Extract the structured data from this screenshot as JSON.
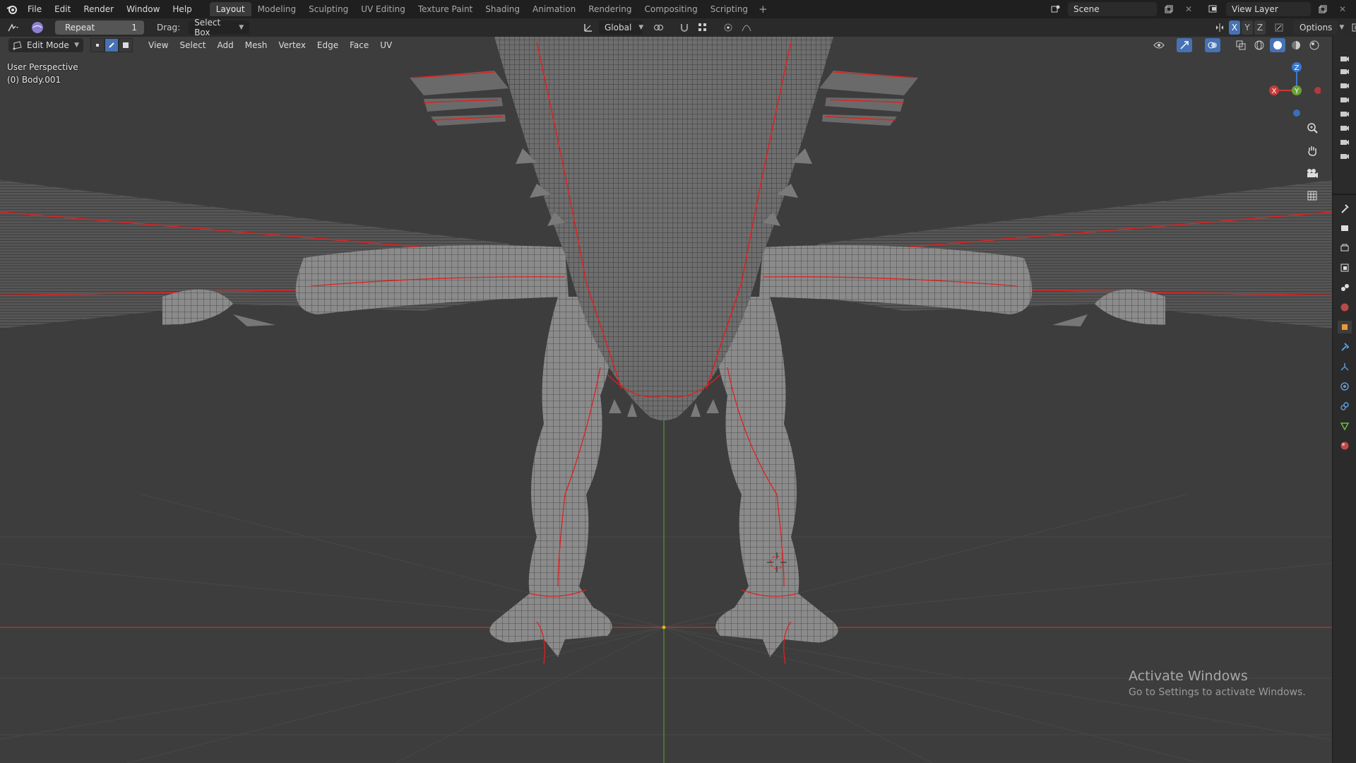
{
  "menus": [
    "File",
    "Edit",
    "Render",
    "Window",
    "Help"
  ],
  "workspaces": [
    "Layout",
    "Modeling",
    "Sculpting",
    "UV Editing",
    "Texture Paint",
    "Shading",
    "Animation",
    "Rendering",
    "Compositing",
    "Scripting"
  ],
  "active_workspace": "Layout",
  "scene": {
    "name": "Scene",
    "view_layer": "View Layer"
  },
  "tool_settings": {
    "repeat_label": "Repeat",
    "repeat_count": "1",
    "drag_label": "Drag:",
    "drag_value": "Select Box",
    "transform_orientation": "Global",
    "options_label": "Options",
    "axes": [
      "X",
      "Y",
      "Z"
    ]
  },
  "viewport_header": {
    "mode": "Edit Mode",
    "menus": [
      "View",
      "Select",
      "Add",
      "Mesh",
      "Vertex",
      "Edge",
      "Face",
      "UV"
    ]
  },
  "overlay": {
    "view_name": "User Perspective",
    "object_name": "(0) Body.001"
  },
  "gizmo_axes": {
    "z": "Z",
    "x": "X",
    "y": "Y"
  },
  "colors": {
    "accent": "#4772b3",
    "seam": "#e02020",
    "grid": "#4a4a4a",
    "x_axis": "#c83a3a",
    "y_axis": "#6aa236",
    "z_axis": "#3a78d0"
  },
  "watermark": {
    "title": "Activate Windows",
    "subtitle": "Go to Settings to activate Windows."
  },
  "icons": [
    "blender-logo",
    "editor-type-icon",
    "mesh-mode-icon",
    "vertex-select-icon",
    "edge-select-icon",
    "face-select-icon",
    "transform-pivot-icon",
    "snap-icon",
    "proportional-edit-icon",
    "zoom-icon",
    "hand-pan-icon",
    "camera-view-icon",
    "ortho-grid-icon",
    "visibility-icon",
    "gizmo-icon",
    "overlay-icon",
    "xray-icon",
    "shading-wire-icon",
    "shading-solid-icon",
    "shading-material-icon",
    "shading-render-icon"
  ]
}
